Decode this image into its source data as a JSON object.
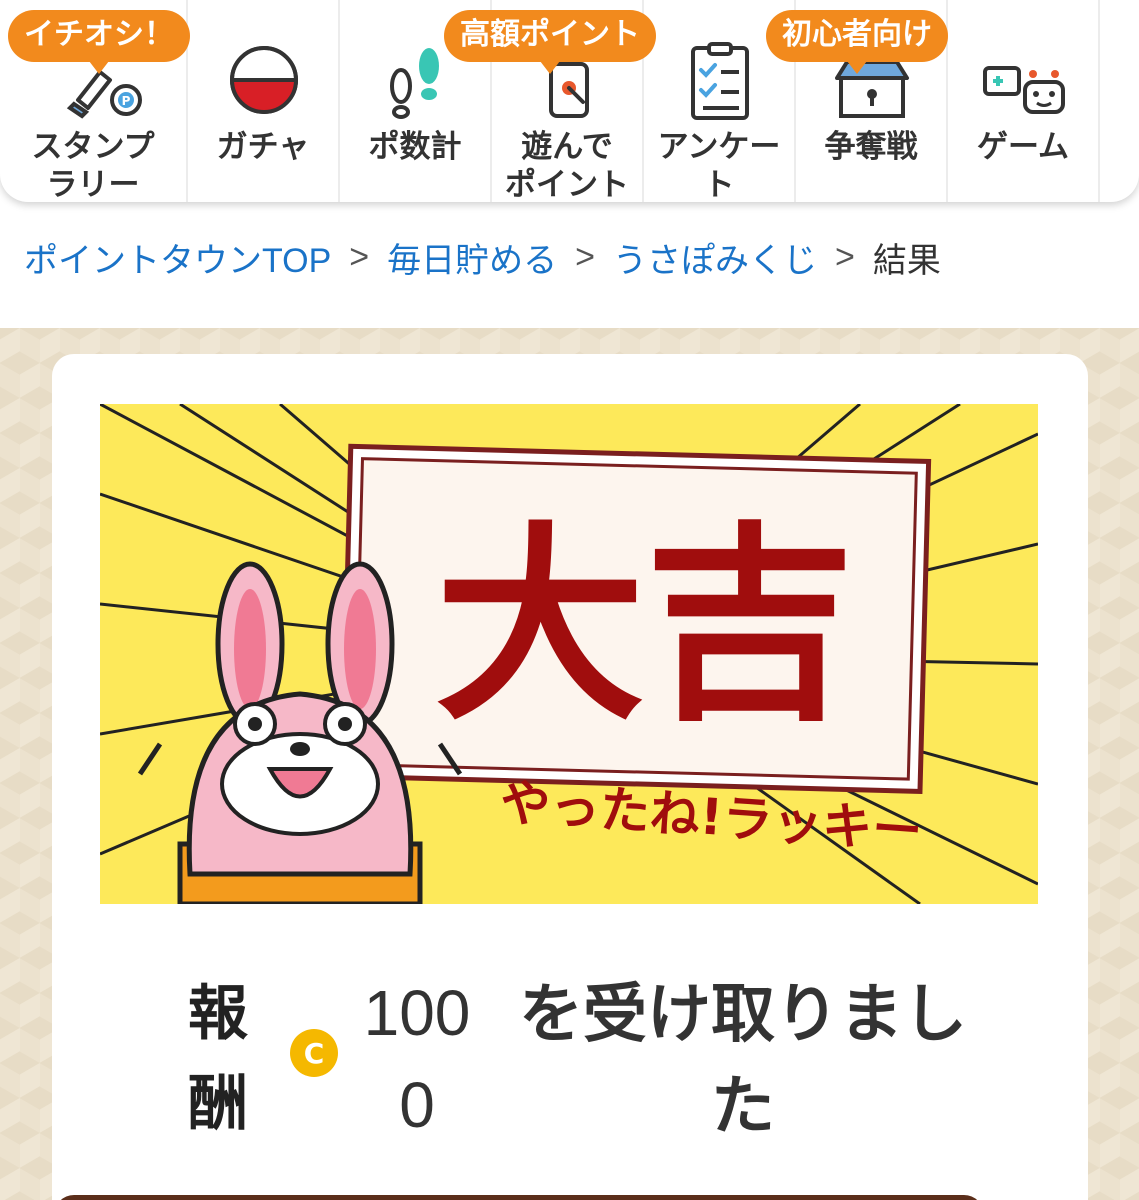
{
  "nav": {
    "items": [
      {
        "label": "スタンプ\nラリー",
        "icon": "stamp-rally-icon",
        "badge": "イチオシ！"
      },
      {
        "label": "ガチャ",
        "icon": "gacha-ball-icon",
        "badge": ""
      },
      {
        "label": "ポ数計",
        "icon": "footprints-icon",
        "badge": ""
      },
      {
        "label": "遊んで\nポイント",
        "icon": "phone-tap-icon",
        "badge": "高額ポイント"
      },
      {
        "label": "アンケー\nト",
        "icon": "survey-clipboard-icon",
        "badge": ""
      },
      {
        "label": "争奪戦",
        "icon": "treasure-box-icon",
        "badge": "初心者向け"
      },
      {
        "label": "ゲーム",
        "icon": "game-robot-icon",
        "badge": ""
      }
    ]
  },
  "breadcrumb": {
    "items": [
      "ポイントタウンTOP",
      "毎日貯める",
      "うさぽみくじ"
    ],
    "current": "結果",
    "separator": ">"
  },
  "result": {
    "fortune": "大吉",
    "message": "やったね!ラッキー",
    "reward_label": "報酬",
    "reward_amount": "1000",
    "reward_suffix": "を受け取りました",
    "coin_symbol": "C"
  },
  "colors": {
    "accent_orange": "#f28a1d",
    "link_blue": "#1a73c8",
    "fortune_red": "#a00d0d",
    "banner_yellow": "#fde95a",
    "coin_gold": "#f5b800"
  }
}
